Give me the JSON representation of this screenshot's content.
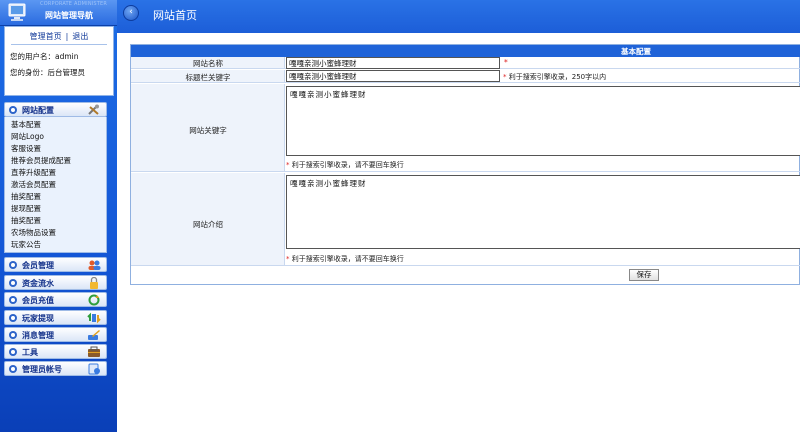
{
  "sidebar": {
    "logo_subtitle": "CORPORATE ADMINISTER",
    "logo_title": "网站管理导航",
    "user_links": {
      "home": "管理首页",
      "separator": "|",
      "logout": "退出"
    },
    "user_name_label": "您的用户名：",
    "user_name_value": "admin",
    "user_role_label": "您的身份：",
    "user_role_value": "后台管理员",
    "open_group": {
      "label": "网站配置",
      "icon": "tools-icon",
      "items": [
        "基本配置",
        "网站Logo",
        "客服设置",
        "推荐会员提成配置",
        "直荐升级配置",
        "激活会员配置",
        "抽奖配置",
        "提现配置",
        "抽奖配置",
        "农场物品设置",
        "玩家公告"
      ]
    },
    "groups": [
      {
        "label": "会员管理",
        "icon": "users-icon"
      },
      {
        "label": "资金流水",
        "icon": "lock-icon"
      },
      {
        "label": "会员充值",
        "icon": "refresh-icon"
      },
      {
        "label": "玩家提现",
        "icon": "exchange-icon"
      },
      {
        "label": "消息管理",
        "icon": "edit-icon"
      },
      {
        "label": "工具",
        "icon": "wrench-icon"
      },
      {
        "label": "管理员帐号",
        "icon": "admin-icon"
      }
    ],
    "colors": {
      "sidebar_bg": "#1356d6",
      "nav_label": "#13318a"
    }
  },
  "topbar": {
    "back_icon": "back-arrow-icon",
    "title": "网站首页"
  },
  "form": {
    "header_title": "基本配置",
    "fields": [
      {
        "label": "网站名称",
        "value": "嘎嘎亲测小蜜蜂理财",
        "required_mark": "*"
      },
      {
        "label": "标题栏关键字",
        "value": "嘎嘎亲测小蜜蜂理财",
        "hint_star": "*",
        "hint": "利于搜索引擎收录，250字以内"
      },
      {
        "label": "网站关键字",
        "value": "嘎嘎亲测小蜜蜂理财",
        "hint_star": "*",
        "hint": "利于搜索引擎收录，请不要回车换行"
      },
      {
        "label": "网站介绍",
        "value": "嘎嘎亲测小蜜蜂理财",
        "hint_star": "*",
        "hint": "利于搜索引擎收录，请不要回车换行"
      }
    ],
    "save_label": "保存"
  }
}
